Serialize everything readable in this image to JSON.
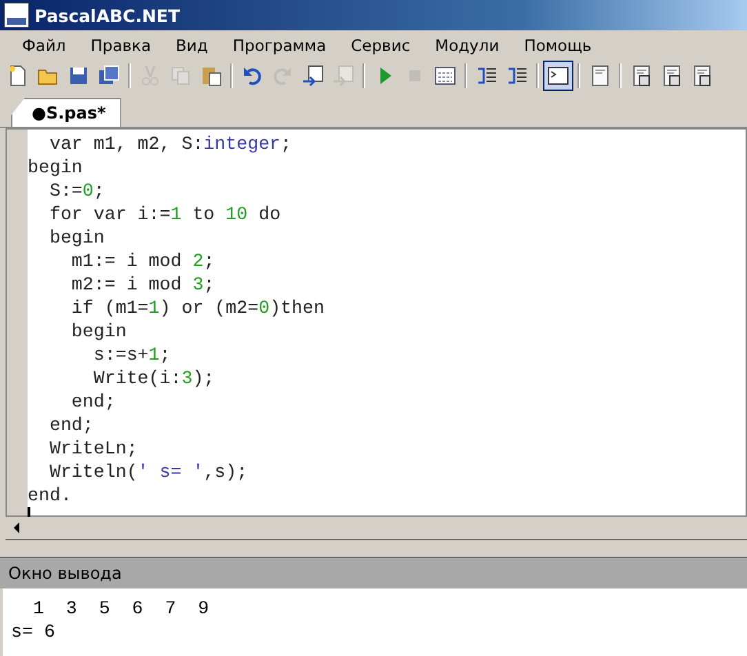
{
  "window": {
    "title": "PascalABC.NET"
  },
  "menu": [
    "Файл",
    "Правка",
    "Вид",
    "Программа",
    "Сервис",
    "Модули",
    "Помощь"
  ],
  "toolbar": [
    [
      {
        "disabled": false,
        "pressed": false
      },
      {
        "disabled": false,
        "pressed": false
      },
      {
        "disabled": false,
        "pressed": false
      },
      {
        "disabled": false,
        "pressed": false
      }
    ],
    [
      {
        "disabled": true,
        "pressed": false
      },
      {
        "disabled": true,
        "pressed": false
      },
      {
        "disabled": false,
        "pressed": false
      }
    ],
    [
      {
        "disabled": false,
        "pressed": false
      },
      {
        "disabled": true,
        "pressed": false
      },
      {
        "disabled": false,
        "pressed": false
      },
      {
        "disabled": true,
        "pressed": false
      }
    ],
    [
      {
        "disabled": false,
        "pressed": false
      },
      {
        "disabled": true,
        "pressed": false
      },
      {
        "disabled": false,
        "pressed": false
      }
    ],
    [
      {
        "disabled": false,
        "pressed": false
      },
      {
        "disabled": false,
        "pressed": false
      }
    ],
    [
      {
        "disabled": false,
        "pressed": true
      }
    ],
    [
      {
        "disabled": false,
        "pressed": false
      }
    ],
    [
      {
        "disabled": false,
        "pressed": false
      },
      {
        "disabled": false,
        "pressed": false
      },
      {
        "disabled": false,
        "pressed": false
      }
    ]
  ],
  "tabs": [
    {
      "label": "●S.pas*",
      "selected": true
    }
  ],
  "editor": {
    "lines": [
      [
        {
          "kind": "plain",
          "text": "  var m1, m2, S:"
        },
        {
          "kind": "type",
          "text": "integer"
        },
        {
          "kind": "plain",
          "text": ";"
        }
      ],
      [
        {
          "kind": "plain",
          "text": "begin"
        }
      ],
      [
        {
          "kind": "plain",
          "text": "  S:="
        },
        {
          "kind": "num",
          "text": "0"
        },
        {
          "kind": "plain",
          "text": ";"
        }
      ],
      [
        {
          "kind": "plain",
          "text": "  for var i:="
        },
        {
          "kind": "num",
          "text": "1"
        },
        {
          "kind": "plain",
          "text": " to "
        },
        {
          "kind": "num",
          "text": "10"
        },
        {
          "kind": "plain",
          "text": " do"
        }
      ],
      [
        {
          "kind": "plain",
          "text": "  begin"
        }
      ],
      [
        {
          "kind": "plain",
          "text": "    m1:= i mod "
        },
        {
          "kind": "num",
          "text": "2"
        },
        {
          "kind": "plain",
          "text": ";"
        }
      ],
      [
        {
          "kind": "plain",
          "text": "    m2:= i mod "
        },
        {
          "kind": "num",
          "text": "3"
        },
        {
          "kind": "plain",
          "text": ";"
        }
      ],
      [
        {
          "kind": "plain",
          "text": "    if (m1="
        },
        {
          "kind": "num",
          "text": "1"
        },
        {
          "kind": "plain",
          "text": ") or (m2="
        },
        {
          "kind": "num",
          "text": "0"
        },
        {
          "kind": "plain",
          "text": ")then"
        }
      ],
      [
        {
          "kind": "plain",
          "text": "    begin"
        }
      ],
      [
        {
          "kind": "plain",
          "text": "      s:=s+"
        },
        {
          "kind": "num",
          "text": "1"
        },
        {
          "kind": "plain",
          "text": ";"
        }
      ],
      [
        {
          "kind": "plain",
          "text": "      Write(i:"
        },
        {
          "kind": "num",
          "text": "3"
        },
        {
          "kind": "plain",
          "text": ");"
        }
      ],
      [
        {
          "kind": "plain",
          "text": "    end;"
        }
      ],
      [
        {
          "kind": "plain",
          "text": "  end;"
        }
      ],
      [
        {
          "kind": "plain",
          "text": "  WriteLn;"
        }
      ],
      [
        {
          "kind": "plain",
          "text": "  Writeln("
        },
        {
          "kind": "str",
          "text": "' s= '"
        },
        {
          "kind": "plain",
          "text": ",s);"
        }
      ],
      [
        {
          "kind": "plain",
          "text": "end."
        }
      ]
    ]
  },
  "output": {
    "title": "Окно вывода",
    "lines": [
      "  1  3  5  6  7  9",
      "s= 6"
    ]
  }
}
